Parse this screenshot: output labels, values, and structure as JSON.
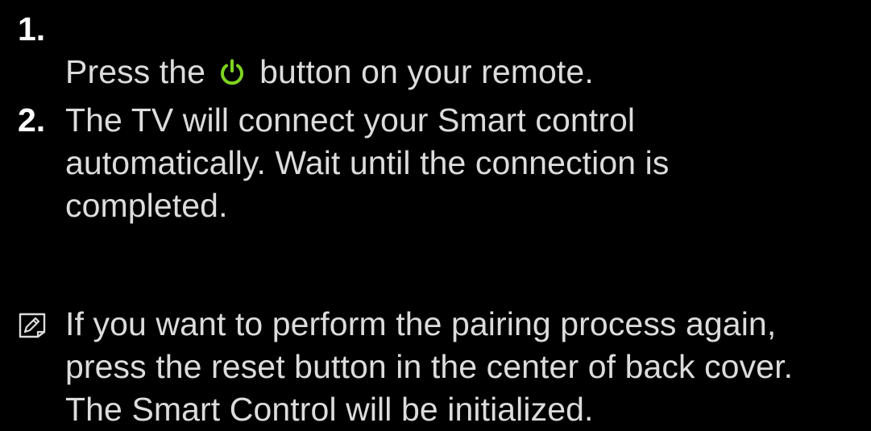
{
  "steps": [
    {
      "number": "1.",
      "text_before": "Press the",
      "icon": "power-icon",
      "text_after": "button on your remote."
    },
    {
      "number": "2.",
      "text": "The TV will connect your Smart control\nautomatically. Wait until the connection is\ncompleted."
    }
  ],
  "note": {
    "icon": "note-pencil-icon",
    "text": "If you want to perform the pairing process again,\npress the reset button in the center of back cover.\nThe Smart Control will be initialized."
  },
  "colors": {
    "background": "#000000",
    "text": "#dcdcdc",
    "accent_power": "#7fd321"
  }
}
